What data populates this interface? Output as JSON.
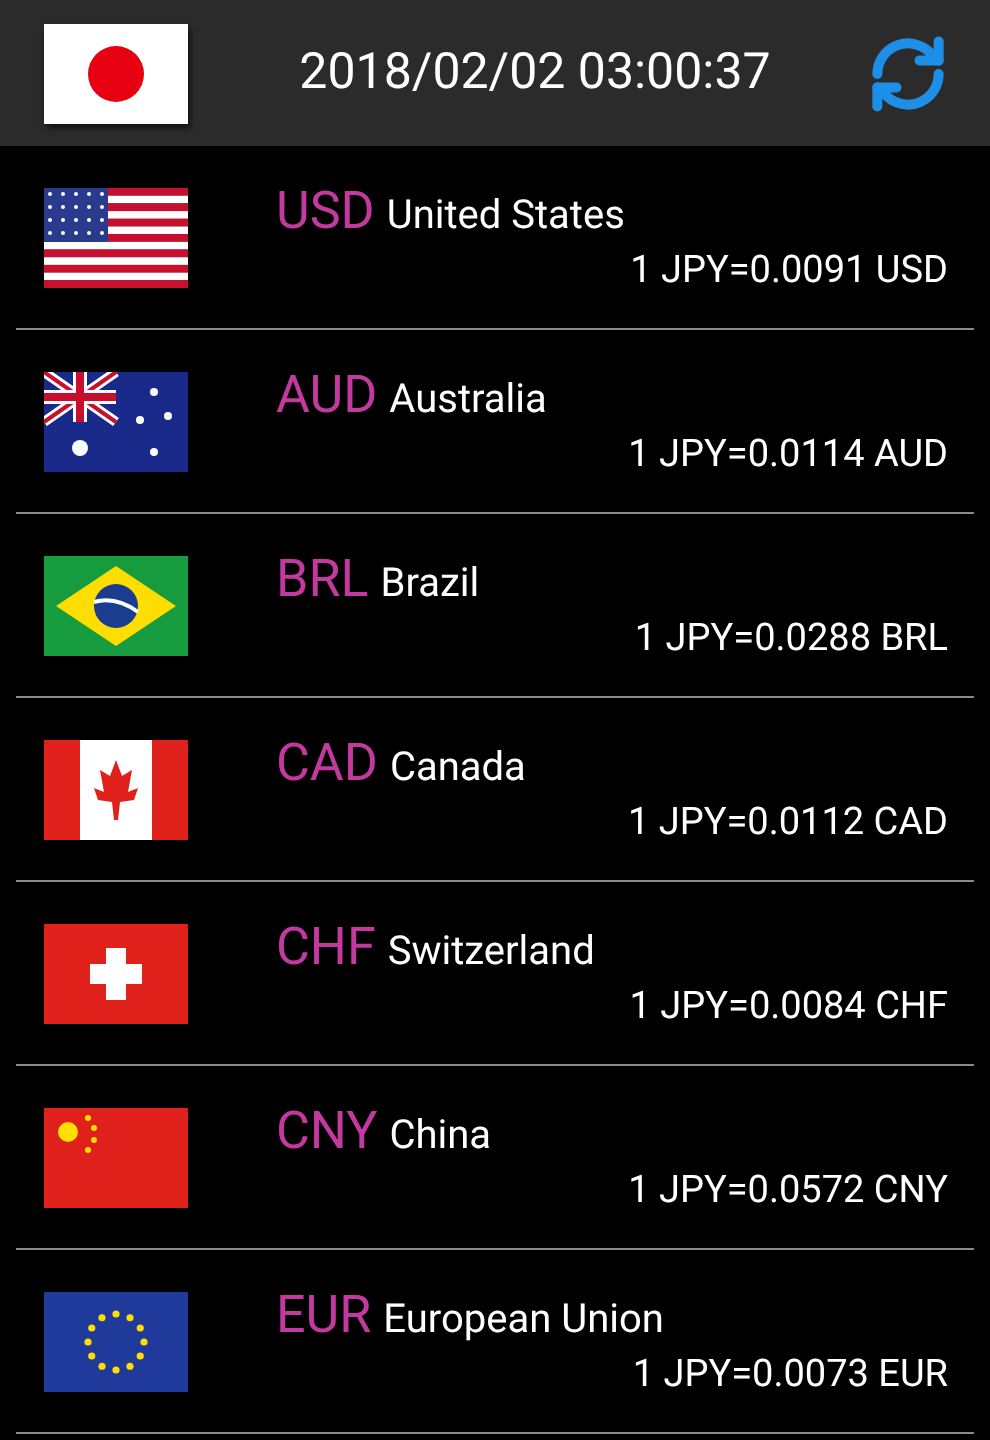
{
  "header": {
    "flag": {
      "kind": "jp"
    },
    "datetime": "2018/02/02 03:00:37"
  },
  "rates": [
    {
      "flag": {
        "kind": "us"
      },
      "code": "USD",
      "country": "United States",
      "rate": "1 JPY=0.0091 USD"
    },
    {
      "flag": {
        "kind": "au"
      },
      "code": "AUD",
      "country": "Australia",
      "rate": "1 JPY=0.0114 AUD"
    },
    {
      "flag": {
        "kind": "br"
      },
      "code": "BRL",
      "country": "Brazil",
      "rate": "1 JPY=0.0288 BRL"
    },
    {
      "flag": {
        "kind": "ca"
      },
      "code": "CAD",
      "country": "Canada",
      "rate": "1 JPY=0.0112 CAD"
    },
    {
      "flag": {
        "kind": "ch"
      },
      "code": "CHF",
      "country": "Switzerland",
      "rate": "1 JPY=0.0084 CHF"
    },
    {
      "flag": {
        "kind": "cn"
      },
      "code": "CNY",
      "country": "China",
      "rate": "1 JPY=0.0572 CNY"
    },
    {
      "flag": {
        "kind": "eu"
      },
      "code": "EUR",
      "country": "European Union",
      "rate": "1 JPY=0.0073 EUR"
    }
  ]
}
